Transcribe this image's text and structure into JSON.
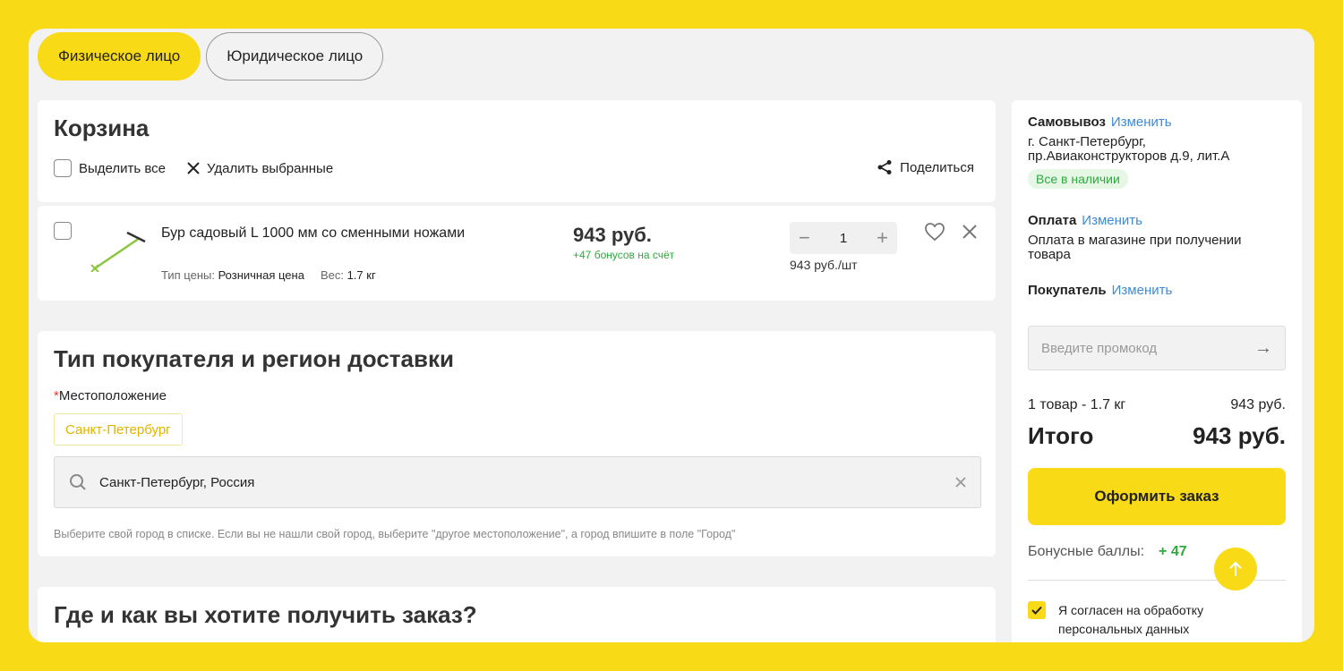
{
  "tabs": [
    {
      "label": "Физическое лицо",
      "active": true
    },
    {
      "label": "Юридическое лицо",
      "active": false
    }
  ],
  "cart": {
    "title": "Корзина",
    "select_all": "Выделить все",
    "delete_selected": "Удалить выбранные",
    "share": "Поделиться",
    "item": {
      "name": "Бур садовый L 1000 мм со сменными ножами",
      "price_type_label": "Тип цены:",
      "price_type": "Розничная цена",
      "weight_label": "Вес:",
      "weight": "1.7 кг",
      "price": "943 руб.",
      "bonus": "+47 бонусов на счёт",
      "qty": "1",
      "unit_price": "943 руб./шт"
    }
  },
  "buyer": {
    "title": "Тип покупателя и регион доставки",
    "location_label": "Местоположение",
    "required_mark": "*",
    "chip": "Санкт-Петербург",
    "search_value": "Санкт-Петербург, Россия",
    "hint": "Выберите свой город в списке. Если вы не нашли свой город, выберите \"другое местоположение\", а город впишите в поле \"Город\""
  },
  "where": {
    "title": "Где и как вы хотите получить заказ?"
  },
  "side": {
    "pickup_label": "Самовывоз",
    "change": "Изменить",
    "address": "г. Санкт-Петербург, пр.Авиаконструкторов д.9, лит.А",
    "stock": "Все в наличии",
    "payment_label": "Оплата",
    "payment_text": "Оплата в магазине при получении товара",
    "buyer_label": "Покупатель",
    "promo_placeholder": "Введите промокод",
    "items_summary": "1 товар - 1.7 кг",
    "items_price": "943 руб.",
    "total_label": "Итого",
    "total_price": "943 руб.",
    "order_button": "Оформить заказ",
    "bonus_label": "Бонусные баллы:",
    "bonus_value": "+ 47",
    "consent": "Я согласен на обработку персональных данных"
  },
  "colors": {
    "accent": "#f9da17",
    "link": "#3d8bd6",
    "green": "#2eaa3e"
  },
  "icons": [
    "close-icon",
    "share-icon",
    "heart-icon",
    "search-icon",
    "arrow-right-icon",
    "arrow-up-icon",
    "check-icon"
  ]
}
